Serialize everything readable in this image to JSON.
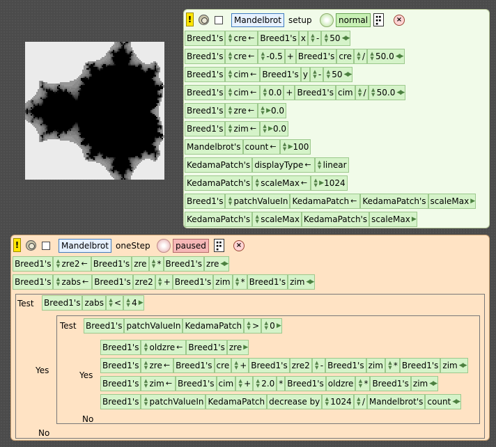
{
  "setup_script": {
    "object": "Mandelbrot",
    "name": "setup",
    "status": "normal",
    "lines": [
      [
        "Breed1's",
        "cre",
        "←",
        "Breed1's",
        "x",
        "-",
        "50"
      ],
      [
        "Breed1's",
        "cre",
        "←",
        "-0.5",
        "+",
        "Breed1's",
        "cre",
        "/",
        "50.0"
      ],
      [
        "Breed1's",
        "cim",
        "←",
        "Breed1's",
        "y",
        "-",
        "50"
      ],
      [
        "Breed1's",
        "cim",
        "←",
        "0.0",
        "+",
        "Breed1's",
        "cim",
        "/",
        "50.0"
      ],
      [
        "Breed1's",
        "zre",
        "←",
        "0.0"
      ],
      [
        "Breed1's",
        "zim",
        "←",
        "0.0"
      ],
      [
        "Mandelbrot's",
        "count",
        "←",
        "100"
      ],
      [
        "KedamaPatch's",
        "displayType",
        "←",
        "linear"
      ],
      [
        "KedamaPatch's",
        "scaleMax",
        "←",
        "1024"
      ],
      [
        "Breed1's",
        "patchValueIn",
        "KedamaPatch",
        "←",
        "KedamaPatch's",
        "scaleMax"
      ],
      [
        "KedamaPatch's",
        "scaleMax",
        "KedamaPatch's",
        "scaleMax"
      ]
    ]
  },
  "step_script": {
    "object": "Mandelbrot",
    "name": "oneStep",
    "status": "paused",
    "lines": [
      [
        "Breed1's",
        "zre2",
        "←",
        "Breed1's",
        "zre",
        "*",
        "Breed1's",
        "zre"
      ],
      [
        "Breed1's",
        "zabs",
        "←",
        "Breed1's",
        "zre2",
        "+",
        "Breed1's",
        "zim",
        "*",
        "Breed1's",
        "zim"
      ]
    ],
    "test_outer": {
      "label": "Test",
      "condition": [
        "Breed1's",
        "zabs",
        "<",
        "4"
      ],
      "yes": "Yes",
      "no": "No"
    },
    "test_inner": {
      "label": "Test",
      "condition": [
        "Breed1's",
        "patchValueIn",
        "KedamaPatch",
        ">",
        "0"
      ],
      "yes": "Yes",
      "no": "No",
      "lines": [
        [
          "Breed1's",
          "oldzre",
          "←",
          "Breed1's",
          "zre"
        ],
        [
          "Breed1's",
          "zre",
          "←",
          "Breed1's",
          "cre",
          "+",
          "Breed1's",
          "zre2",
          "-",
          "Breed1's",
          "zim",
          "*",
          "Breed1's",
          "zim"
        ],
        [
          "Breed1's",
          "zim",
          "←",
          "Breed1's",
          "cim",
          "+",
          "2.0",
          "*",
          "Breed1's",
          "oldzre",
          "*",
          "Breed1's",
          "zim"
        ],
        [
          "Breed1's",
          "patchValueIn",
          "KedamaPatch",
          "decrease by",
          "1024",
          "/",
          "Mandelbrot's",
          "count"
        ]
      ]
    }
  },
  "colors": {
    "setup_bg": "#f1fbe9",
    "step_bg": "#ffe3c4",
    "tile": "#d5f3c9",
    "normal": "#c8f0b4",
    "paused": "#f6b7b7"
  },
  "icons": [
    "exclamation-icon",
    "go-button-icon",
    "checkbox-icon",
    "tick-clock-icon",
    "menu-icon",
    "close-icon"
  ]
}
